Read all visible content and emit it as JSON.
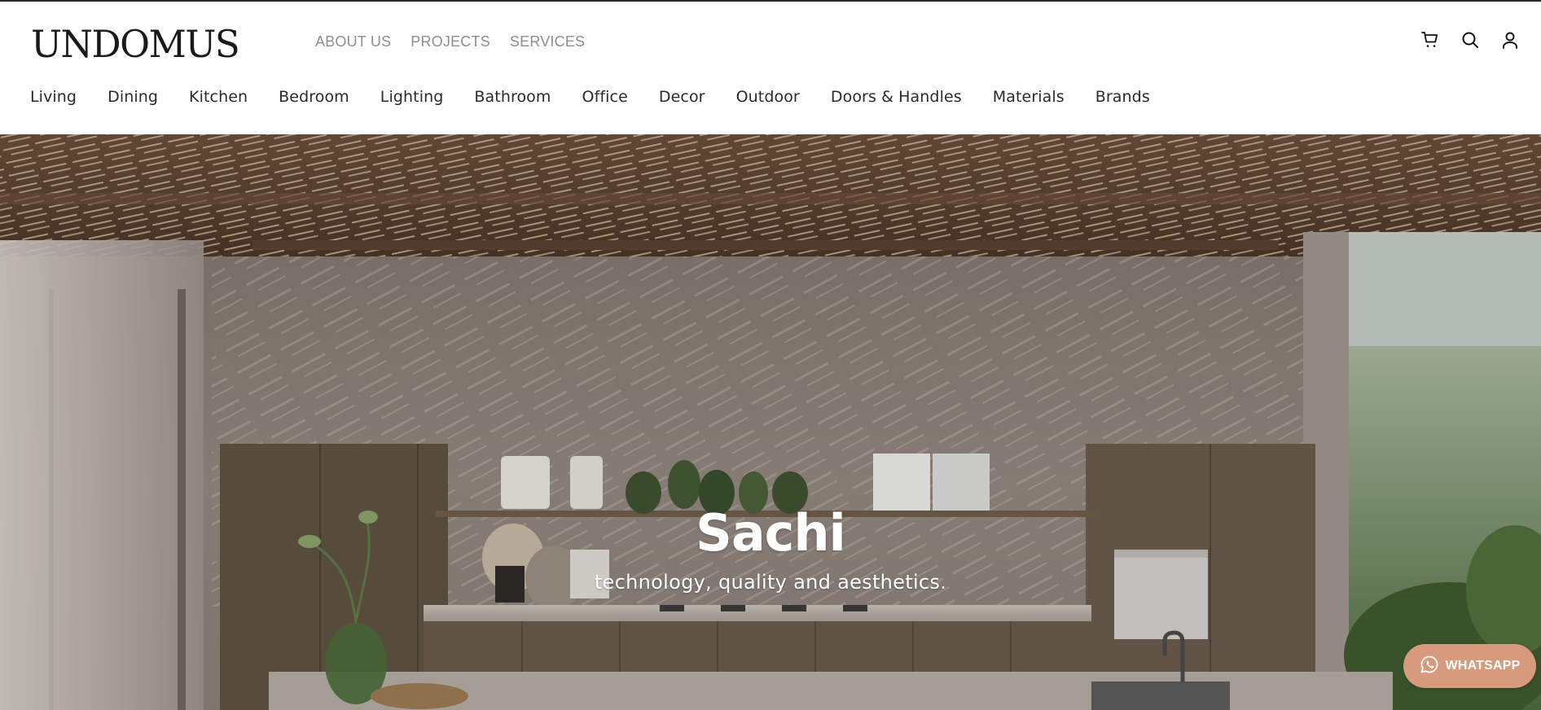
{
  "brand": {
    "logo_text": "UNDOMUS"
  },
  "top_nav": {
    "items": [
      {
        "label": "ABOUT US"
      },
      {
        "label": "PROJECTS"
      },
      {
        "label": "SERVICES"
      }
    ]
  },
  "header_icons": [
    "cart-icon",
    "search-icon",
    "account-icon"
  ],
  "category_nav": {
    "items": [
      {
        "label": "Living"
      },
      {
        "label": "Dining"
      },
      {
        "label": "Kitchen"
      },
      {
        "label": "Bedroom"
      },
      {
        "label": "Lighting"
      },
      {
        "label": "Bathroom"
      },
      {
        "label": "Office"
      },
      {
        "label": "Decor"
      },
      {
        "label": "Outdoor"
      },
      {
        "label": "Doors & Handles"
      },
      {
        "label": "Materials"
      },
      {
        "label": "Brands"
      }
    ]
  },
  "hero": {
    "title": "Sachi",
    "subtitle": "technology, quality and aesthetics."
  },
  "whatsapp": {
    "label": "WHATSAPP",
    "color": "#d79a7c"
  },
  "colors": {
    "text_dark": "#1a1a1a",
    "top_nav_gray": "#8e8e8e",
    "hero_text": "#ffffff"
  }
}
